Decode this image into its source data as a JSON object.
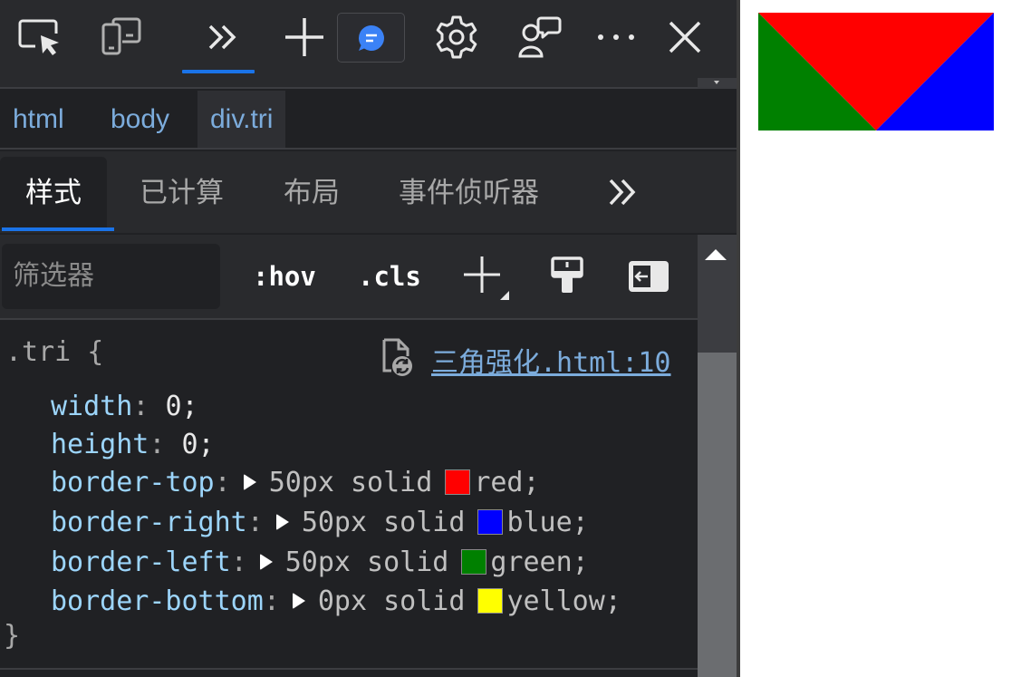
{
  "toolbar": {
    "icons": [
      "inspect-icon",
      "device-emulation-icon",
      "more-tools-icon",
      "add-icon",
      "feedback-icon",
      "settings-icon",
      "customize-icon",
      "more-options-icon",
      "close-icon"
    ]
  },
  "breadcrumb": {
    "items": [
      "html",
      "body",
      "div.tri"
    ]
  },
  "panel_tabs": {
    "items": [
      "样式",
      "已计算",
      "布局",
      "事件侦听器"
    ]
  },
  "filter": {
    "placeholder": "筛选器",
    "hov": ":hov",
    "cls": ".cls"
  },
  "rule": {
    "selector": ".tri {",
    "source": "三角强化.html:10",
    "close": "}",
    "declarations": [
      {
        "prop": "width",
        "value": "0;"
      },
      {
        "prop": "height",
        "value": "0;"
      },
      {
        "prop": "border-top",
        "value": "50px solid",
        "color_name": "red;",
        "color": "#ff0000"
      },
      {
        "prop": "border-right",
        "value": "50px solid",
        "color_name": "blue;",
        "color": "#0000ff"
      },
      {
        "prop": "border-left",
        "value": "50px solid",
        "color_name": "green;",
        "color": "#008000"
      },
      {
        "prop": "border-bottom",
        "value": "0px solid",
        "color_name": "yellow;",
        "color": "#ffff00"
      }
    ]
  },
  "colors": {
    "accent": "#1a73e8",
    "link": "#7cacdc",
    "property": "#9cd5fb"
  }
}
